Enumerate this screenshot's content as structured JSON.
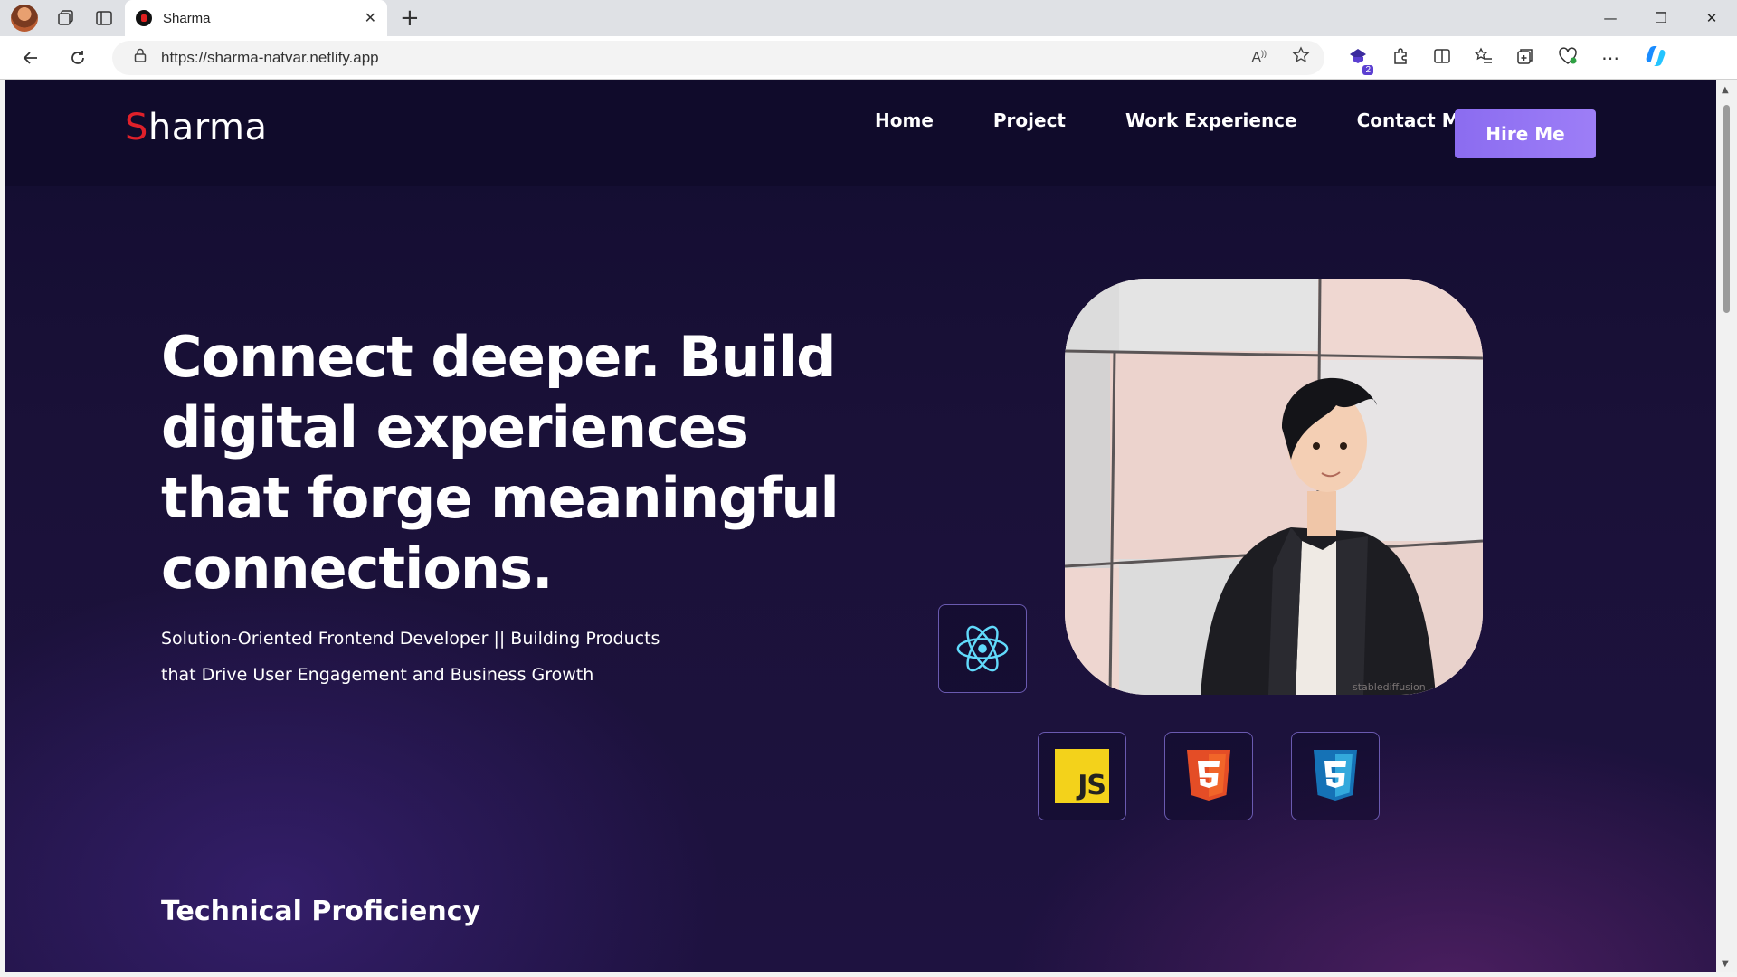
{
  "browser": {
    "tab_title": "Sharma",
    "url": "https://sharma-natvar.netlify.app",
    "extension_badge_count": "2"
  },
  "site": {
    "logo_first_letter": "S",
    "logo_rest": "harma",
    "nav": [
      "Home",
      "Project",
      "Work Experience",
      "Contact Me"
    ],
    "hire_button": "Hire Me"
  },
  "hero": {
    "title": "Connect deeper. Build digital experiences that forge meaningful connections.",
    "subtitle_line1": "Solution-Oriented Frontend Developer || Building Products",
    "subtitle_line2": "that Drive User Engagement and Business Growth",
    "portrait_watermark": "stablediffusion",
    "tech_badges": [
      {
        "name": "react-icon",
        "label": "React",
        "color": "#61dafb"
      },
      {
        "name": "javascript-icon",
        "label": "JS",
        "color": "#f3d21b"
      },
      {
        "name": "html5-icon",
        "label": "5",
        "color": "#e44d26"
      },
      {
        "name": "css3-icon",
        "label": "3",
        "color": "#2965f1"
      }
    ]
  },
  "sections": {
    "technical_title": "Technical Proficiency"
  },
  "colors": {
    "background": "#120c30",
    "accent": "#9d7ef7",
    "logo_red": "#e0202a"
  }
}
